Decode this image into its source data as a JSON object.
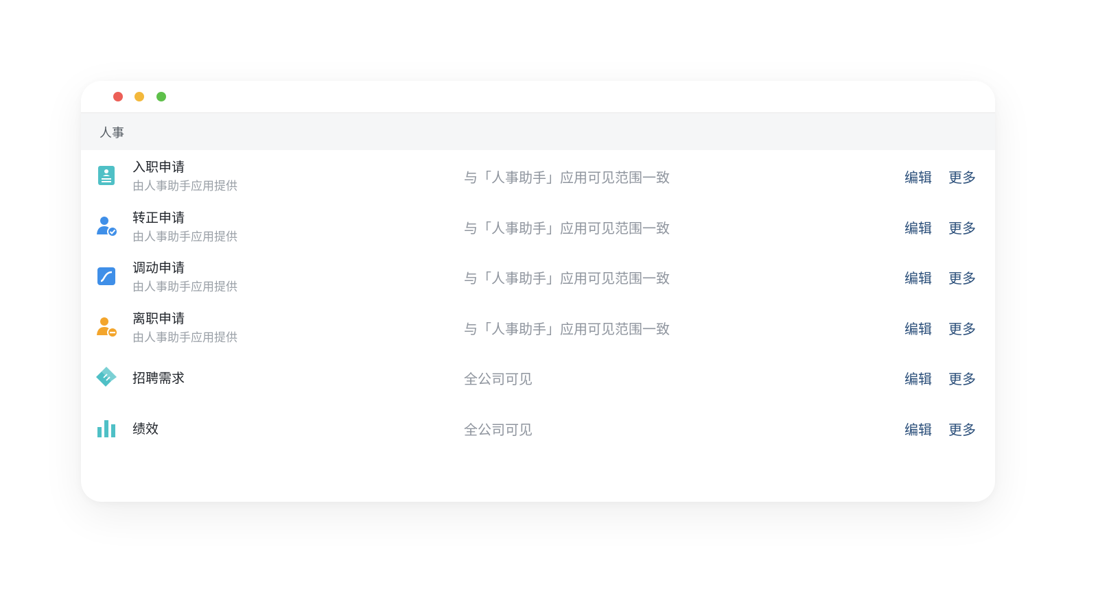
{
  "window": {
    "controls": [
      "close",
      "minimize",
      "maximize"
    ]
  },
  "section": {
    "title": "人事"
  },
  "colors": {
    "accent_teal": "#4fc0c6",
    "accent_blue": "#3f8fe8",
    "accent_orange": "#f3a52c",
    "link": "#2b4f7a"
  },
  "rows": [
    {
      "title": "入职申请",
      "subtitle": "由人事助手应用提供",
      "scope": "与「人事助手」应用可见范围一致",
      "icon": "onboarding-form-icon",
      "edit_label": "编辑",
      "more_label": "更多"
    },
    {
      "title": "转正申请",
      "subtitle": "由人事助手应用提供",
      "scope": "与「人事助手」应用可见范围一致",
      "icon": "user-check-icon",
      "edit_label": "编辑",
      "more_label": "更多"
    },
    {
      "title": "调动申请",
      "subtitle": "由人事助手应用提供",
      "scope": "与「人事助手」应用可见范围一致",
      "icon": "transfer-curve-icon",
      "edit_label": "编辑",
      "more_label": "更多"
    },
    {
      "title": "离职申请",
      "subtitle": "由人事助手应用提供",
      "scope": "与「人事助手」应用可见范围一致",
      "icon": "user-minus-icon",
      "edit_label": "编辑",
      "more_label": "更多"
    },
    {
      "title": "招聘需求",
      "subtitle": "",
      "scope": "全公司可见",
      "icon": "handshake-icon",
      "edit_label": "编辑",
      "more_label": "更多"
    },
    {
      "title": "绩效",
      "subtitle": "",
      "scope": "全公司可见",
      "icon": "bar-chart-icon",
      "edit_label": "编辑",
      "more_label": "更多"
    }
  ]
}
